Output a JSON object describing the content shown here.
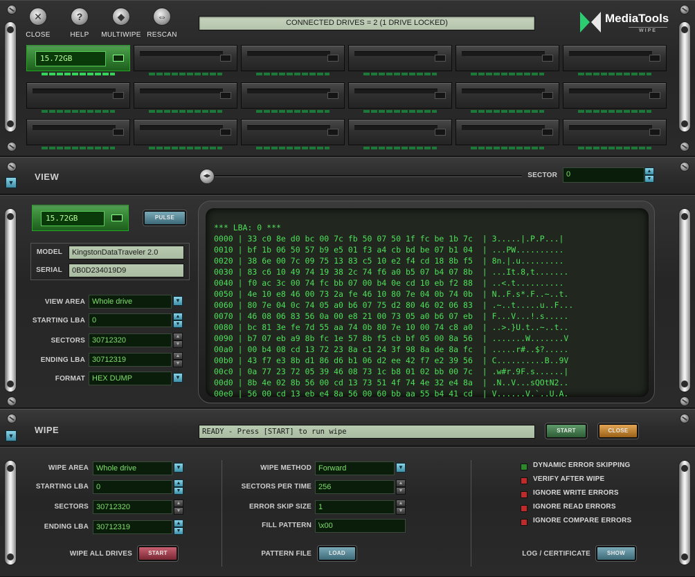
{
  "toolbar": {
    "close": "CLOSE",
    "help": "HELP",
    "multiwipe": "MULTIWIPE",
    "rescan": "RESCAN",
    "help_glyph": "?",
    "close_glyph": "✕",
    "rescan_glyph": "⇔",
    "multiwipe_glyph": "◆"
  },
  "status": {
    "connected": "CONNECTED DRIVES = 2 (1 DRIVE LOCKED)"
  },
  "logo": {
    "name": "MediaTools",
    "sub": "WIPE"
  },
  "drives": {
    "active_capacity": "15.72GB"
  },
  "view": {
    "title": "VIEW",
    "sector_label": "SECTOR",
    "sector_value": "0",
    "capacity": "15.72GB",
    "pulse": "PULSE",
    "model_label": "MODEL",
    "model": "KingstonDataTraveler 2.0",
    "serial_label": "SERIAL",
    "serial": "0B0D234019D9",
    "view_area_label": "VIEW AREA",
    "view_area": "Whole drive",
    "starting_lba_label": "STARTING LBA",
    "starting_lba": "0",
    "sectors_label": "SECTORS",
    "sectors": "30712320",
    "ending_lba_label": "ENDING LBA",
    "ending_lba": "30712319",
    "format_label": "FORMAT",
    "format": "HEX DUMP"
  },
  "hexdump": {
    "header": "*** LBA: 0 ***",
    "lines": [
      "0000 | 33 c0 8e d0 bc 00 7c fb 50 07 50 1f fc be 1b 7c  | 3.....|.P.P...|",
      "0010 | bf 1b 06 50 57 b9 e5 01 f3 a4 cb bd be 07 b1 04  | ...PW..........",
      "0020 | 38 6e 00 7c 09 75 13 83 c5 10 e2 f4 cd 18 8b f5  | 8n.|.u.........",
      "0030 | 83 c6 10 49 74 19 38 2c 74 f6 a0 b5 07 b4 07 8b  | ...It.8,t.......",
      "0040 | f0 ac 3c 00 74 fc bb 07 00 b4 0e cd 10 eb f2 88  | ..<.t..........",
      "0050 | 4e 10 e8 46 00 73 2a fe 46 10 80 7e 04 0b 74 0b  | N..F.s*.F..~..t.",
      "0060 | 80 7e 04 0c 74 05 a0 b6 07 75 d2 80 46 02 06 83  | .~..t.....u..F...",
      "0070 | 46 08 06 83 56 0a 00 e8 21 00 73 05 a0 b6 07 eb  | F...V...!.s.....",
      "0080 | bc 81 3e fe 7d 55 aa 74 0b 80 7e 10 00 74 c8 a0  | ..>.}U.t..~..t..",
      "0090 | b7 07 eb a9 8b fc 1e 57 8b f5 cb bf 05 00 8a 56  | .......W.......V",
      "00a0 | 00 b4 08 cd 13 72 23 8a c1 24 3f 98 8a de 8a fc  | .....r#..$?.....",
      "00b0 | 43 f7 e3 8b d1 86 d6 b1 06 d2 ee 42 f7 e2 39 56  | C..........B..9V",
      "00c0 | 0a 77 23 72 05 39 46 08 73 1c b8 01 02 bb 00 7c  | .w#r.9F.s......|",
      "00d0 | 8b 4e 02 8b 56 00 cd 13 73 51 4f 74 4e 32 e4 8a  | .N..V...sQOtN2..",
      "00e0 | 56 00 cd 13 eb e4 8a 56 00 60 bb aa 55 b4 41 cd  | V......V.`..U.A."
    ]
  },
  "wipe": {
    "title": "WIPE",
    "status": "READY - Press [START] to run wipe",
    "start": "START",
    "close": "CLOSE",
    "wipe_area_label": "WIPE AREA",
    "wipe_area": "Whole drive",
    "starting_lba_label": "STARTING LBA",
    "starting_lba": "0",
    "sectors_label": "SECTORS",
    "sectors": "30712320",
    "ending_lba_label": "ENDING LBA",
    "ending_lba": "30712319",
    "wipe_all_label": "WIPE ALL DRIVES",
    "wipe_all_btn": "START",
    "method_label": "WIPE METHOD",
    "method": "Forward",
    "spt_label": "SECTORS PER TIME",
    "spt": "256",
    "skip_label": "ERROR SKIP SIZE",
    "skip": "1",
    "fill_label": "FILL PATTERN",
    "fill": "\\x00",
    "pattern_file_label": "PATTERN FILE",
    "load": "LOAD",
    "log_label": "LOG / CERTIFICATE",
    "show": "SHOW",
    "options": [
      {
        "label": "DYNAMIC ERROR SKIPPING",
        "checked": true
      },
      {
        "label": "VERIFY AFTER WIPE",
        "checked": false
      },
      {
        "label": "IGNORE WRITE ERRORS",
        "checked": false
      },
      {
        "label": "IGNORE READ ERRORS",
        "checked": false
      },
      {
        "label": "IGNORE COMPARE ERRORS",
        "checked": false
      }
    ]
  },
  "icons": {
    "dropdown": "▼",
    "up": "▲",
    "down": "▼",
    "slider": "◀▶"
  },
  "colors": {
    "lcd_green": "#4ee05a",
    "accent_blue": "#3e8fa8",
    "check_off": "#c02a2a",
    "check_on": "#2a8a2a"
  }
}
